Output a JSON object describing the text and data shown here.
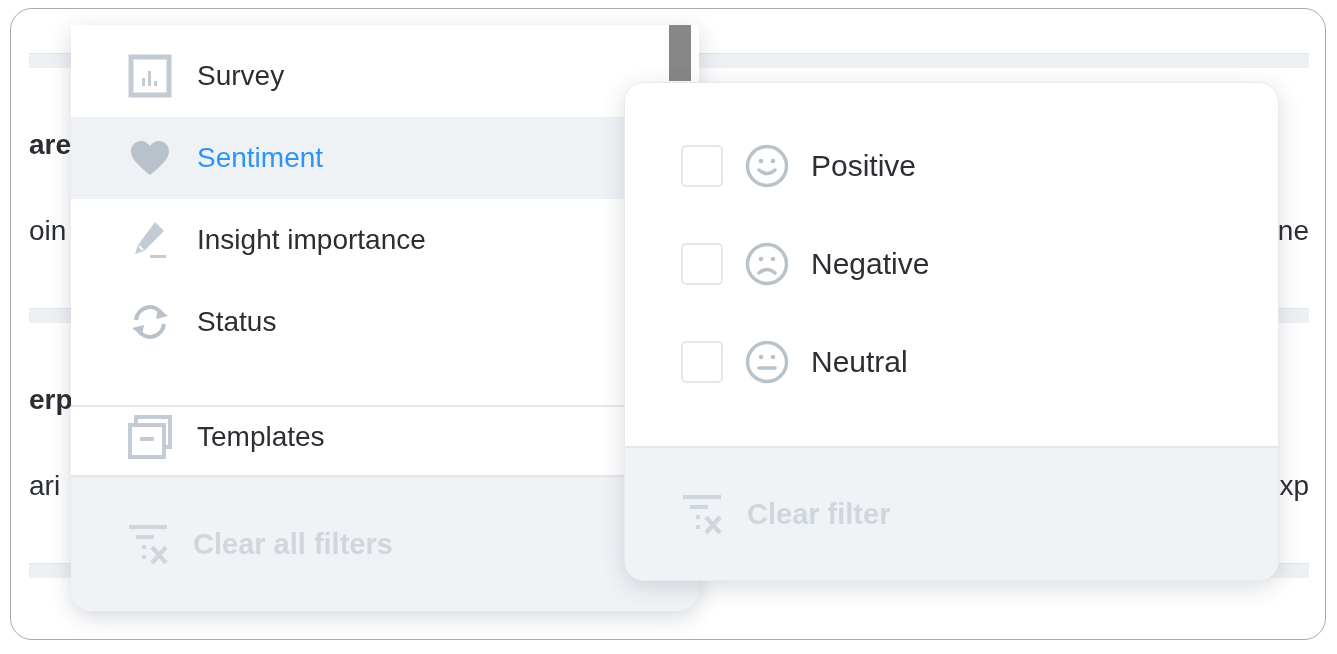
{
  "background": {
    "rows": [
      {
        "kind": "heading",
        "left": "are"
      },
      {
        "kind": "text",
        "left": "oin",
        "right": "ne"
      },
      {
        "kind": "heading",
        "left": "erp"
      },
      {
        "kind": "text",
        "left": "ari",
        "right": "xp"
      }
    ]
  },
  "filter_menu": {
    "items": [
      {
        "kind": "survey",
        "label": "Survey",
        "selected": false
      },
      {
        "kind": "heart",
        "label": "Sentiment",
        "selected": true
      },
      {
        "kind": "pen",
        "label": "Insight importance",
        "selected": false
      },
      {
        "kind": "refresh",
        "label": "Status",
        "selected": false
      }
    ],
    "extra_items": [
      {
        "kind": "templates",
        "label": "Templates",
        "selected": false
      }
    ],
    "footer": {
      "label": "Clear all filters",
      "disabled": true
    }
  },
  "sentiment_popover": {
    "options": [
      {
        "kind": "smile",
        "label": "Positive",
        "checked": false
      },
      {
        "kind": "frown",
        "label": "Negative",
        "checked": false
      },
      {
        "kind": "flat",
        "label": "Neutral",
        "checked": false
      }
    ],
    "footer": {
      "label": "Clear filter",
      "disabled": true
    }
  }
}
